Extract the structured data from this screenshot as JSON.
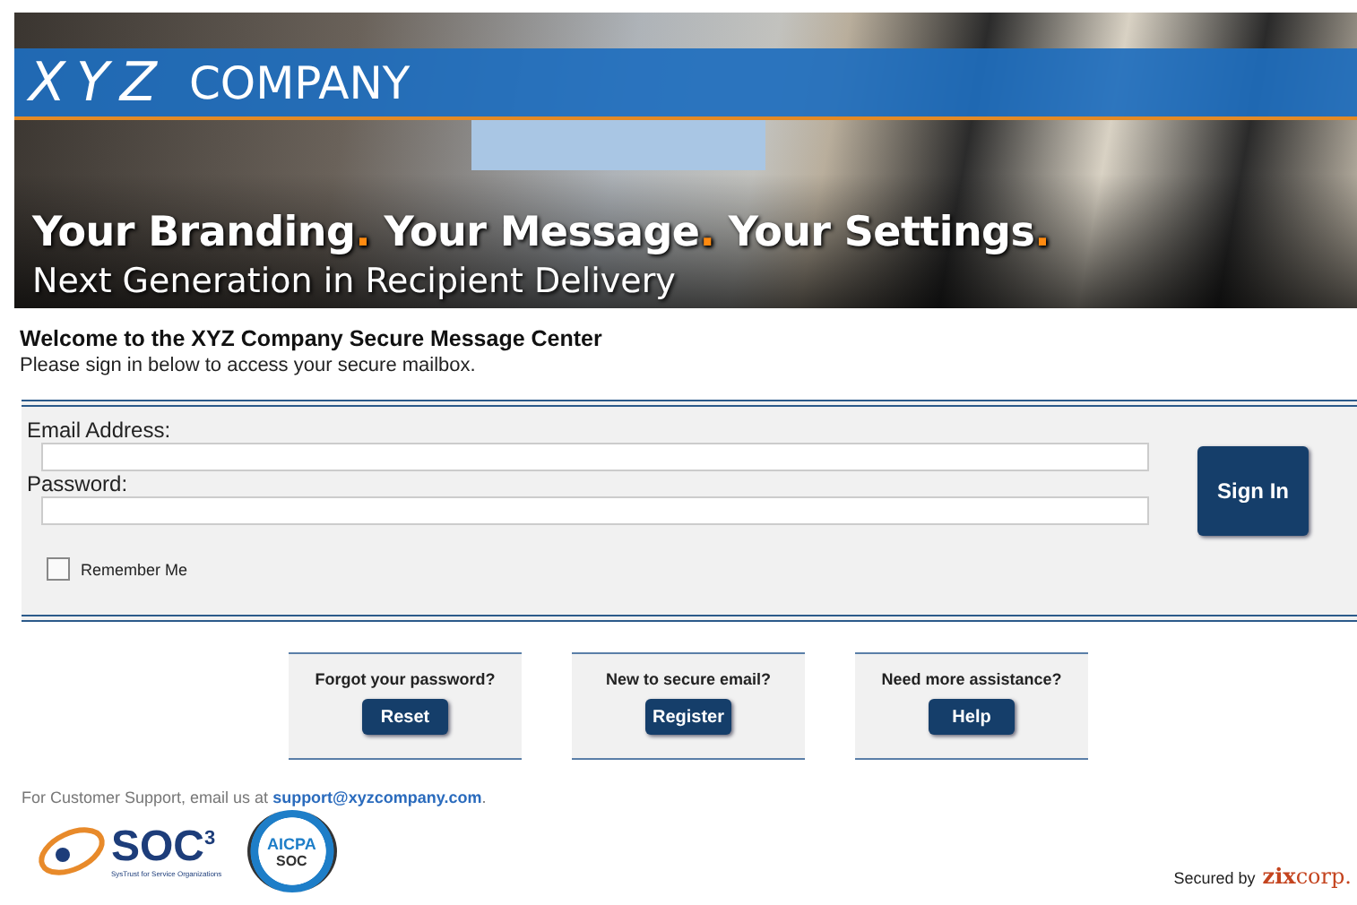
{
  "banner": {
    "logo_mark": "XYZ",
    "logo_name": "COMPANY",
    "headline_parts": [
      {
        "kind": "word",
        "text": "Your Branding"
      },
      {
        "kind": "dot",
        "text": "."
      },
      {
        "kind": "word",
        "text": " Your Message"
      },
      {
        "kind": "dot",
        "text": "."
      },
      {
        "kind": "word",
        "text": " Your Settings"
      },
      {
        "kind": "dot",
        "text": "."
      }
    ],
    "subline": "Next Generation in Recipient Delivery"
  },
  "welcome": {
    "title": "Welcome to the XYZ Company Secure Message Center",
    "subtitle": "Please sign in below to access your secure mailbox."
  },
  "form": {
    "fields": [
      {
        "label": "Email Address:"
      },
      {
        "label": "Password:"
      }
    ],
    "remember": {
      "label": "Remember Me",
      "checked": false
    },
    "submit": "Sign In"
  },
  "help_boxes": [
    {
      "question": "Forgot your password?",
      "button": "Reset"
    },
    {
      "question": "New to secure email?",
      "button": "Register"
    },
    {
      "question": "Need more assistance?",
      "button": "Help"
    }
  ],
  "support": {
    "text": "For Customer Support, email us at ",
    "link": "support@xyzcompany.com",
    "after": "."
  },
  "badges": {
    "soc3": "SOC$^{3}$",
    "soc3_caption": "SysTrust for Service Organizations",
    "aicpa": "AICPA",
    "aicpa_soc": "SOC"
  },
  "secured": {
    "text": "Secured by",
    "brand_bold": "zix",
    "brand_light": "corp."
  }
}
